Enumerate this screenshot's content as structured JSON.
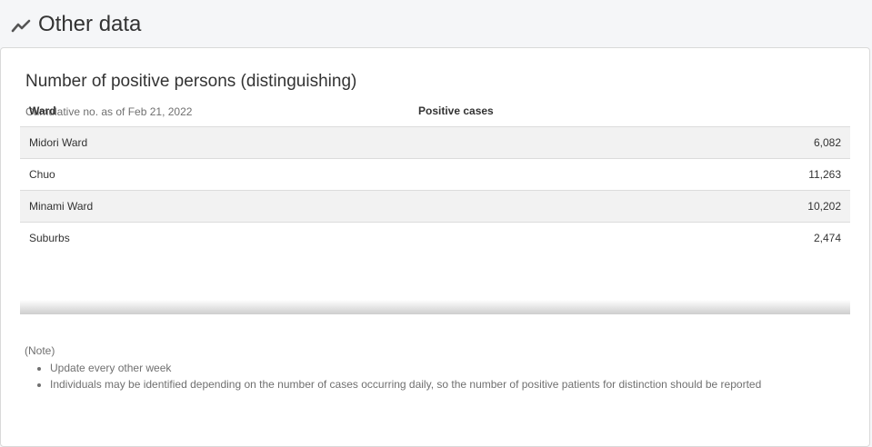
{
  "section": {
    "title": "Other data",
    "icon": "chart-line-icon"
  },
  "card": {
    "title": "Number of positive persons (distinguishing)",
    "subtitle": "Cumulative no. as of Feb 21, 2022"
  },
  "table": {
    "headers": [
      "Ward",
      "Positive cases"
    ],
    "rows": [
      {
        "ward": "Midori Ward",
        "cases": "6,082"
      },
      {
        "ward": "Chuo",
        "cases": "11,263"
      },
      {
        "ward": "Minami Ward",
        "cases": "10,202"
      },
      {
        "ward": "Suburbs",
        "cases": "2,474"
      }
    ]
  },
  "notes": {
    "heading": "(Note)",
    "items": [
      "Update every other week",
      "Individuals may be identified depending on the number of cases occurring daily, so the number of positive patients for distinction should be reported"
    ]
  }
}
